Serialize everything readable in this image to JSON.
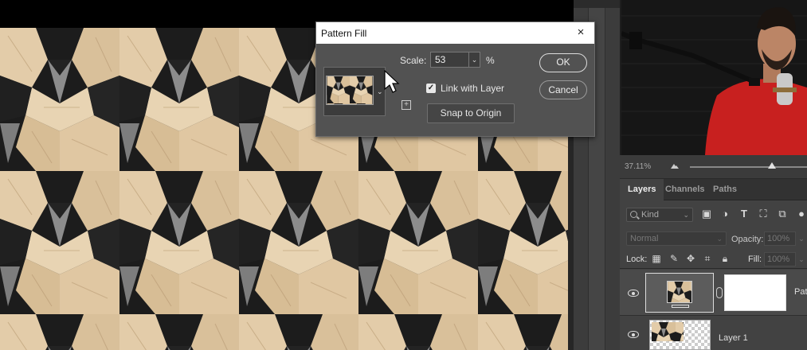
{
  "dialog": {
    "title": "Pattern Fill",
    "close_glyph": "×",
    "scale_label": "Scale:",
    "scale_value": "53",
    "scale_unit": "%",
    "link_checked": true,
    "link_label": "Link with Layer",
    "snap_label": "Snap to Origin",
    "ok_label": "OK",
    "cancel_label": "Cancel"
  },
  "navigator": {
    "zoom": "37.11%"
  },
  "layers_panel": {
    "tabs": [
      "Layers",
      "Channels",
      "Paths"
    ],
    "active_tab": "Layers",
    "filter_kind": "Kind",
    "blend_mode": "Normal",
    "opacity_label": "Opacity:",
    "opacity_value": "100%",
    "lock_label": "Lock:",
    "fill_label": "Fill:",
    "fill_value": "100%",
    "layers": [
      {
        "name": "Patt",
        "visible": true,
        "type": "pattern-fill"
      },
      {
        "name": "Layer 1",
        "visible": true,
        "type": "pixel"
      }
    ]
  },
  "icons": {
    "filter": [
      "image-icon",
      "adjustment-icon",
      "type-icon",
      "shape-icon",
      "smart-object-icon",
      "filter-toggle-icon"
    ],
    "lock": [
      "lock-transparent-icon",
      "lock-paint-icon",
      "lock-position-icon",
      "lock-artboard-icon",
      "lock-all-icon"
    ]
  },
  "colors": {
    "wood": "#e2cba8",
    "wood_shade": "#c9ae88",
    "dark_block": "#2a2a2a",
    "shadow_gray": "#8e8e8e",
    "panel_bg": "#424242",
    "dialog_bg": "#525252"
  }
}
